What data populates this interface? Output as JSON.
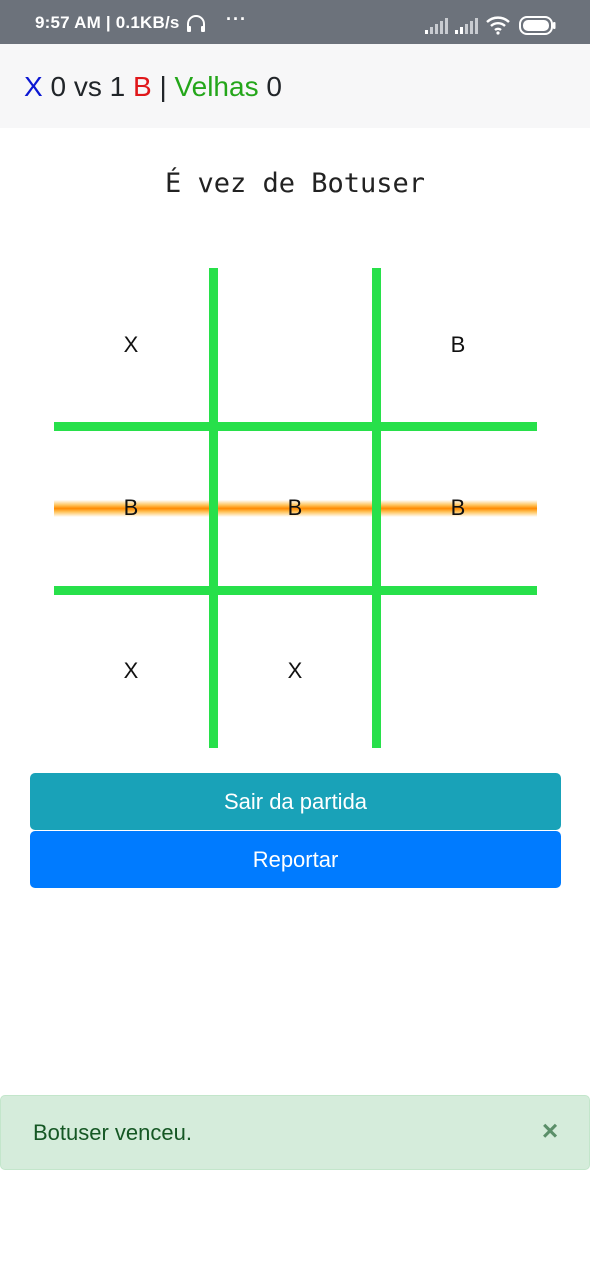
{
  "status_bar": {
    "time": "9:57 AM",
    "network_speed": "0.1KB/s",
    "icons": [
      "headphone-icon",
      "more-dots-icon",
      "signal-icon",
      "signal-icon",
      "wifi-icon",
      "battery-icon"
    ]
  },
  "score": {
    "player_x_symbol": "X",
    "player_x_score": "0",
    "vs": "vs",
    "player_b_score": "1",
    "player_b_symbol": "B",
    "separator": "|",
    "draws_label": "Velhas",
    "draws_count": "0"
  },
  "turn_text": "É vez de Botuser",
  "board": {
    "cells": [
      [
        "X",
        "",
        "B"
      ],
      [
        "B",
        "B",
        "B"
      ],
      [
        "X",
        "X",
        ""
      ]
    ],
    "winning_row": 1,
    "grid_color": "#27e04a",
    "win_highlight_color": "#ff8a00"
  },
  "buttons": {
    "leave_label": "Sair da partida",
    "report_label": "Reportar"
  },
  "alert": {
    "message": "Botuser venceu.",
    "close_symbol": "×"
  },
  "colors": {
    "x_color": "#0b17d3",
    "b_color": "#e0171a",
    "draws_color": "#24a61a",
    "leave_button": "#19a2b8",
    "report_button": "#007bff",
    "alert_bg": "#d5ecdb",
    "alert_text": "#155724"
  }
}
